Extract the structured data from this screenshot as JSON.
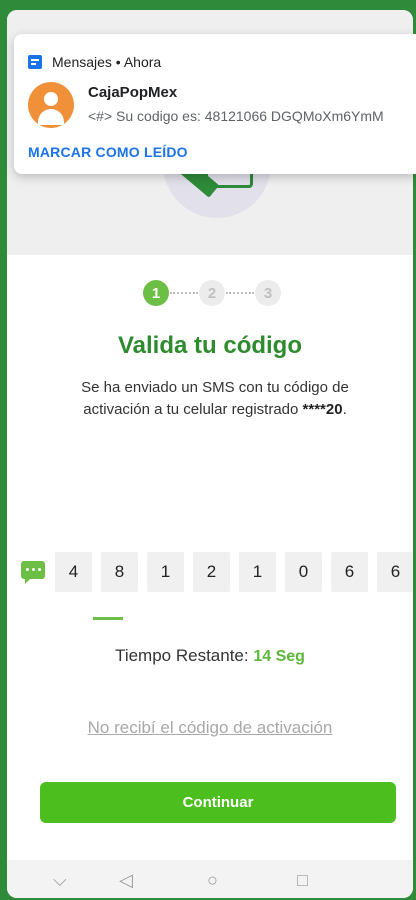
{
  "notification": {
    "app": "Mensajes • Ahora",
    "sender": "CajaPopMex",
    "body": "<#> Su codigo es: 48121066 DGQMoXm6YmM",
    "action": "MARCAR COMO LEÍDO"
  },
  "steps": [
    "1",
    "2",
    "3"
  ],
  "title": "Valida tu código",
  "description": {
    "text": "Se ha enviado un SMS con tu código de activación a tu celular registrado",
    "masked_number": "****20",
    "period": "."
  },
  "code_digits": [
    "4",
    "8",
    "1",
    "2",
    "1",
    "0",
    "6",
    "6"
  ],
  "timer": {
    "label": "Tiempo Restante:",
    "value": "14 Seg"
  },
  "resend_link": "No recibí el código de activación",
  "continue_button": "Continuar",
  "nav": {
    "down": "⌵",
    "back": "◁",
    "home": "○",
    "recents": "□"
  },
  "colors": {
    "brand_green": "#2f8a3a",
    "accent_green": "#4cbe1e",
    "notification_blue": "#1a73e8"
  }
}
